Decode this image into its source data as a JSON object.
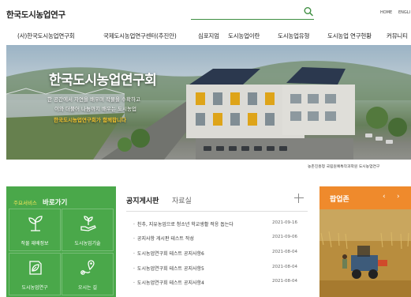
{
  "header": {
    "logo": "한국도시농업연구",
    "search": {
      "placeholder": ""
    },
    "links": [
      "HOME",
      "ENGLI"
    ]
  },
  "nav": {
    "items": [
      "(사)한국도시농업연구회",
      "국제도시농업연구센터(추진안)",
      "심포지엄",
      "도시농업이란",
      "도시농업유형",
      "도시농업 연구현황",
      "커뮤니티"
    ]
  },
  "hero": {
    "title": "한국도시농업연구회",
    "line1": "한 공간에서 자연을 배우며 작물을 수확하고",
    "line2": "이와 더불어 나눔까지 배우는 도시농업",
    "tagline": "한국도시농업연구회가 함께합니다",
    "caption": "농촌진흥청 국립원예특작과학원 도시농업연구"
  },
  "quick": {
    "tag": "주요서비스",
    "title": "바로가기",
    "items": [
      {
        "label": "작물 재배정보",
        "icon": "sprout-icon"
      },
      {
        "label": "도시농업기술",
        "icon": "plant-hand-icon"
      },
      {
        "label": "도시농업연구",
        "icon": "leaf-book-icon"
      },
      {
        "label": "오시는 길",
        "icon": "map-pin-icon"
      }
    ]
  },
  "board": {
    "tabs": [
      "공지게시판",
      "자료실"
    ],
    "notices": [
      {
        "title": "친추, 지유농업으로 청소년 학교생활 적응 돕는다",
        "date": "2021-09-16"
      },
      {
        "title": "공지사항 게시판 테스트 작성",
        "date": "2021-09-06"
      },
      {
        "title": "도시농업연구회 테스트 공지사항6",
        "date": "2021-08-04"
      },
      {
        "title": "도시농업연구회 테스트 공지사항5",
        "date": "2021-08-04"
      },
      {
        "title": "도시농업연구회 테스트 공지사항4",
        "date": "2021-08-04"
      }
    ]
  },
  "popup": {
    "title": "팝업존",
    "prev": "‹",
    "next": "›"
  },
  "colors": {
    "accent_green": "#4aa84a",
    "popup_orange": "#ef8a2c",
    "tagline_yellow": "#f4c430"
  }
}
